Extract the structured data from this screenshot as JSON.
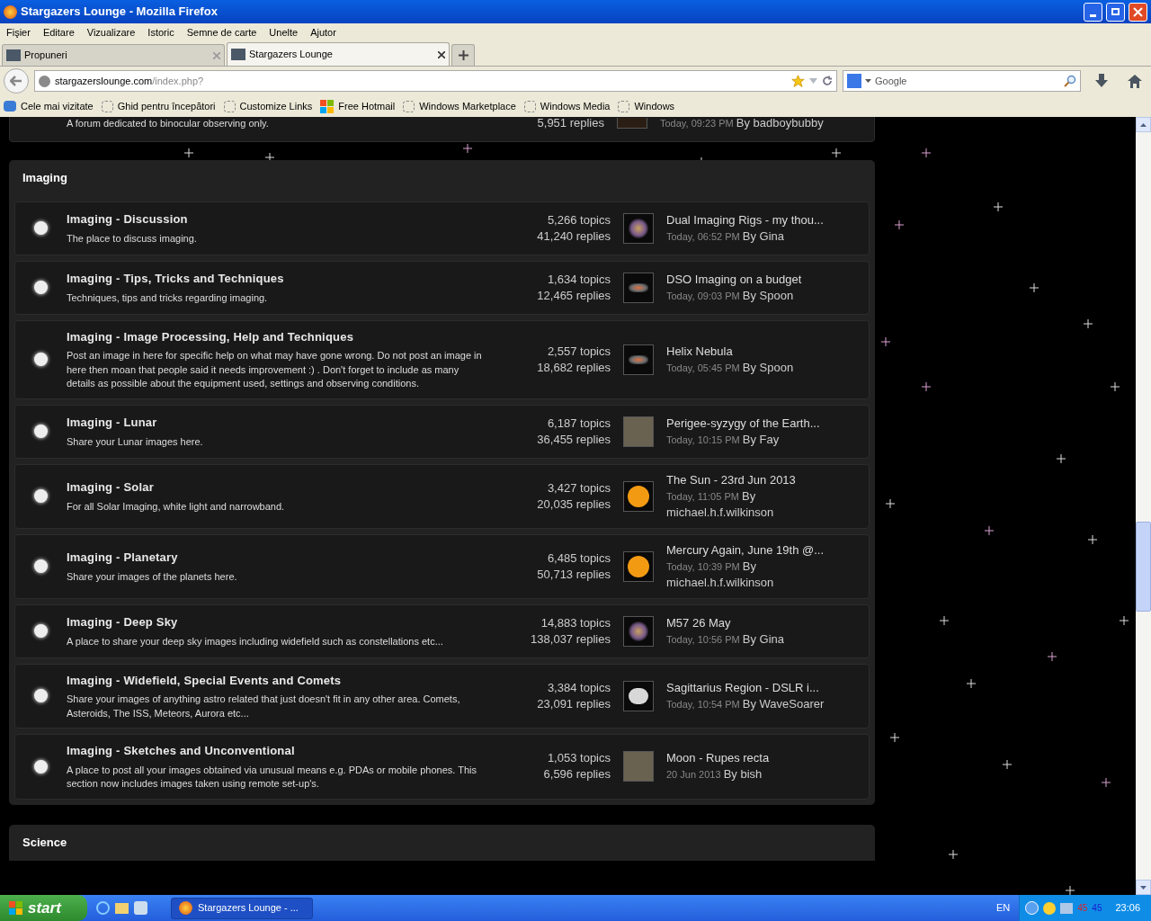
{
  "window": {
    "title": "Stargazers Lounge - Mozilla Firefox"
  },
  "menu": [
    "Fişier",
    "Editare",
    "Vizualizare",
    "Istoric",
    "Semne de carte",
    "Unelte",
    "Ajutor"
  ],
  "tabs": [
    {
      "label": "Propuneri",
      "selected": false
    },
    {
      "label": "Stargazers Lounge",
      "selected": true
    }
  ],
  "url": {
    "host": "stargazerslounge.com",
    "path": "/index.php?"
  },
  "search": {
    "placeholder": "Google"
  },
  "bookmarks": [
    {
      "label": "Cele mai vizitate",
      "kind": "folder"
    },
    {
      "label": "Ghid pentru începători",
      "kind": "page"
    },
    {
      "label": "Customize Links",
      "kind": "page"
    },
    {
      "label": "Free Hotmail",
      "kind": "windows"
    },
    {
      "label": "Windows Marketplace",
      "kind": "page"
    },
    {
      "label": "Windows Media",
      "kind": "page"
    },
    {
      "label": "Windows",
      "kind": "page"
    }
  ],
  "partial_row": {
    "description": "A forum dedicated to binocular observing only.",
    "replies": "5,951 replies",
    "last_date": "Today, 09:23 PM",
    "last_by": "By badboybubby"
  },
  "section": {
    "title": "Imaging",
    "forums": [
      {
        "title": "Imaging - Discussion",
        "description": "The place to discuss imaging.",
        "topics": "5,266 topics",
        "replies": "41,240 replies",
        "last_title": "Dual Imaging Rigs - my thou...",
        "last_date": "Today, 06:52 PM",
        "last_by": "By Gina",
        "kind": "nebula"
      },
      {
        "title": "Imaging - Tips, Tricks and Techniques",
        "description": "Techniques, tips and tricks regarding imaging.",
        "topics": "1,634 topics",
        "replies": "12,465 replies",
        "last_title": "DSO Imaging on a budget",
        "last_date": "Today, 09:03 PM",
        "last_by": "By Spoon",
        "kind": "galaxy"
      },
      {
        "title": "Imaging - Image Processing, Help and Techniques",
        "description": "Post an image in here for specific help on what may have gone wrong. Do not post an image in here then moan that people said it needs improvement :) . Don't forget to include as many details as possible about the equipment used, settings and observing conditions.",
        "topics": "2,557 topics",
        "replies": "18,682 replies",
        "last_title": "Helix Nebula",
        "last_date": "Today, 05:45 PM",
        "last_by": "By Spoon",
        "kind": "galaxy"
      },
      {
        "title": "Imaging - Lunar",
        "description": "Share your Lunar images here.",
        "topics": "6,187 topics",
        "replies": "36,455 replies",
        "last_title": "Perigee-syzygy of the Earth...",
        "last_date": "Today, 10:15 PM",
        "last_by": "By Fay",
        "kind": "photo"
      },
      {
        "title": "Imaging - Solar",
        "description": "For all Solar Imaging, white light and narrowband.",
        "topics": "3,427 topics",
        "replies": "20,035 replies",
        "last_title": "The Sun - 23rd Jun 2013",
        "last_date": "Today, 11:05 PM",
        "last_by": "By michael.h.f.wilkinson",
        "kind": "sun"
      },
      {
        "title": "Imaging - Planetary",
        "description": "Share your images of the planets here.",
        "topics": "6,485 topics",
        "replies": "50,713 replies",
        "last_title": "Mercury Again, June 19th @...",
        "last_date": "Today, 10:39 PM",
        "last_by": "By michael.h.f.wilkinson",
        "kind": "sun"
      },
      {
        "title": "Imaging - Deep Sky",
        "description": "A place to share your deep sky images including widefield such as constellations etc...",
        "topics": "14,883 topics",
        "replies": "138,037 replies",
        "last_title": "M57 26 May",
        "last_date": "Today, 10:56 PM",
        "last_by": "By Gina",
        "kind": "nebula"
      },
      {
        "title": "Imaging - Widefield, Special Events and Comets",
        "description": "Share your images of anything astro related that just doesn't fit in any other area. Comets, Asteroids, The ISS, Meteors, Aurora etc...",
        "topics": "3,384 topics",
        "replies": "23,091 replies",
        "last_title": "Sagittarius Region - DSLR i...",
        "last_date": "Today, 10:54 PM",
        "last_by": "By WaveSoarer",
        "kind": "moon"
      },
      {
        "title": "Imaging - Sketches and Unconventional",
        "description": "A place to post all your images obtained via unusual means e.g. PDAs or mobile phones. This section now includes images taken using remote set-up's.",
        "topics": "1,053 topics",
        "replies": "6,596 replies",
        "last_title": "Moon - Rupes recta",
        "last_date": "20 Jun 2013",
        "last_by": "By bish",
        "kind": "photo"
      }
    ]
  },
  "next_section": {
    "title": "Science"
  },
  "taskbar": {
    "start": "start",
    "task": "Stargazers Lounge - ...",
    "language": "EN",
    "tray_numbers": [
      "45",
      "45"
    ],
    "clock": "23:06"
  }
}
